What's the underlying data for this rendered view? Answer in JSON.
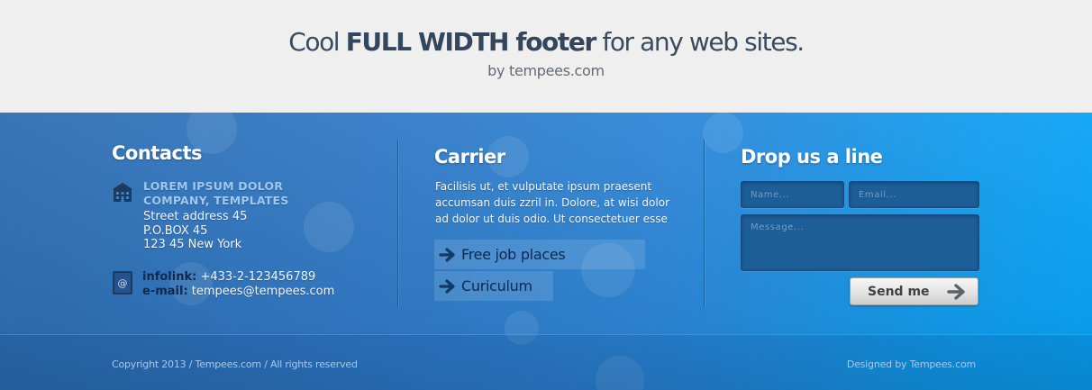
{
  "header": {
    "headline_pre": "Cool ",
    "headline_bold": "FULL WIDTH footer",
    "headline_post": " for any web sites.",
    "byline": "by tempees.com"
  },
  "contacts": {
    "title": "Contacts",
    "company": "LOREM IPSUM DOLOR COMPANY, TEMPLATES",
    "address": [
      "Street address 45",
      "P.O.BOX 45",
      "123 45 New York"
    ],
    "infolink_label": "infolink:",
    "infolink_value": "+433-2-123456789",
    "email_label": "e-mail:",
    "email_value": "tempees@tempees.com",
    "icons": {
      "address": "building-icon",
      "contact": "address-book-icon"
    }
  },
  "carrier": {
    "title": "Carrier",
    "text": "Facilisis ut, et vulputate ipsum praesent accumsan duis zzril in. Dolore, at wisi dolor ad dolor ut duis odio. Ut consectetuer esse",
    "links": [
      {
        "label": "Free job places",
        "icon": "arrow-right-icon"
      },
      {
        "label": "Curiculum",
        "icon": "arrow-right-icon"
      }
    ]
  },
  "drop_line": {
    "title": "Drop us a line",
    "name_placeholder": "Name...",
    "email_placeholder": "Email...",
    "message_placeholder": "Message...",
    "send_label": "Send me"
  },
  "bottom": {
    "copyright": "Copyright 2013 / Tempees.com / All rights reserved",
    "designed": "Designed by Tempees.com"
  },
  "colors": {
    "header_bg": "#efefef",
    "footer_from": "#2f6eb2",
    "footer_to": "#0aa6f8",
    "dark_text": "#0f2a4c",
    "company_text": "#9cc8f2"
  }
}
